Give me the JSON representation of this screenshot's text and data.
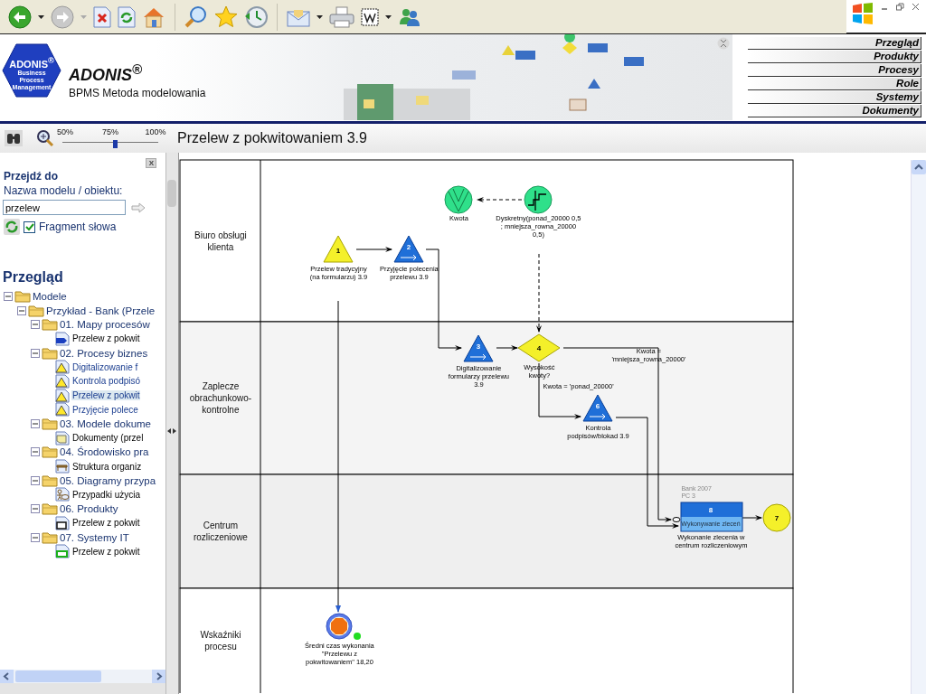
{
  "header": {
    "logo": "ADONIS$^{®}$",
    "logo_subtitle": "Business Process Management",
    "title": "ADONIS$^{®}$",
    "subtitle": "BPMS Metoda modelowania"
  },
  "nav": [
    {
      "label": "Przegląd"
    },
    {
      "label": "Produkty"
    },
    {
      "label": "Procesy"
    },
    {
      "label": "Role"
    },
    {
      "label": "Systemy"
    },
    {
      "label": "Dokumenty"
    }
  ],
  "zoom": {
    "ticks": [
      "50%",
      "75%",
      "100%"
    ],
    "level": 0.53
  },
  "model_title": "Przelew z pokwitowaniem 3.9",
  "sidebar": {
    "close": "X",
    "goto_heading": "Przejdź do",
    "field_label": "Nazwa modelu / obiektu:",
    "search": {
      "value": "przelew"
    },
    "fragment": {
      "label": "Fragment słowa",
      "checked": true
    },
    "overview_heading": "Przegląd",
    "tree": [
      {
        "kind": "folder",
        "label": "Modele",
        "expanded": true,
        "selected": false,
        "children": [
          {
            "kind": "folder",
            "label": "Przykład - Bank (Przele",
            "expanded": true,
            "selected": false,
            "children": [
              {
                "kind": "folder",
                "label": "01. Mapy procesów",
                "expanded": true,
                "selected": false,
                "children": [
                  {
                    "kind": "map",
                    "label": "Przelew z pokwit",
                    "selected": false
                  }
                ]
              },
              {
                "kind": "folder",
                "label": "02. Procesy biznes",
                "expanded": true,
                "selected": false,
                "children": [
                  {
                    "kind": "process",
                    "label": "Digitalizowanie f",
                    "selected": false
                  },
                  {
                    "kind": "process",
                    "label": "Kontrola podpisó",
                    "selected": false
                  },
                  {
                    "kind": "process",
                    "label": "Przelew z pokwit",
                    "selected": true
                  },
                  {
                    "kind": "process",
                    "label": "Przyjęcie polece",
                    "selected": false
                  }
                ]
              },
              {
                "kind": "folder",
                "label": "03. Modele dokume",
                "expanded": true,
                "selected": false,
                "children": [
                  {
                    "kind": "document",
                    "label": "Dokumenty (przel",
                    "selected": false
                  }
                ]
              },
              {
                "kind": "folder",
                "label": "04. Środowisko pra",
                "expanded": true,
                "selected": false,
                "children": [
                  {
                    "kind": "org",
                    "label": "Struktura organiz",
                    "selected": false
                  }
                ]
              },
              {
                "kind": "folder",
                "label": "05. Diagramy przypa",
                "expanded": true,
                "selected": false,
                "children": [
                  {
                    "kind": "usecase",
                    "label": "Przypadki użycia",
                    "selected": false
                  }
                ]
              },
              {
                "kind": "folder",
                "label": "06. Produkty",
                "expanded": true,
                "selected": false,
                "children": [
                  {
                    "kind": "product",
                    "label": "Przelew z pokwit",
                    "selected": false
                  }
                ]
              },
              {
                "kind": "folder",
                "label": "07. Systemy IT",
                "expanded": true,
                "selected": false,
                "children": [
                  {
                    "kind": "system",
                    "label": "Przelew z pokwit",
                    "selected": false
                  }
                ]
              }
            ]
          }
        ]
      }
    ]
  },
  "diagram": {
    "lanes": [
      {
        "label": "Biuro obsługi klienta"
      },
      {
        "label": "Zaplecze obrachunkowo-kontrolne"
      },
      {
        "label": "Centrum rozliczeniowe"
      },
      {
        "label": "Wskaźniki procesu"
      }
    ],
    "nodes": [
      {
        "kind": "variable",
        "label": "Kwota"
      },
      {
        "kind": "generator",
        "label": "Dyskretny(ponad_20000 0,5 ; mniejsza_rowna_20000 0,5)"
      },
      {
        "kind": "start",
        "number": "1",
        "label": "Przelew tradycyjny (na formularzu) 3.9"
      },
      {
        "kind": "activity",
        "number": "2",
        "label": "Przyjęcie polecenia przelewu 3.9"
      },
      {
        "kind": "activity",
        "number": "3",
        "label": "Digitalizowanie formularzy przelewu 3.9"
      },
      {
        "kind": "decision",
        "number": "4",
        "label": "Wysokość kwoty?"
      },
      {
        "kind": "activity",
        "number": "6",
        "label": "Kontrola podpisów/blokad 3.9"
      },
      {
        "kind": "subprocess",
        "number": "8",
        "caption": "Wykonywanie zleceń",
        "notes": [
          "Bank 2007",
          "PC 3"
        ],
        "label": "Wykonanie zlecenia w centrum rozliczeniowym"
      },
      {
        "kind": "end",
        "number": "7"
      },
      {
        "kind": "indicator",
        "label": "Średni czas wykonania \"Przelewu z pokwitowaniem\" 18,20",
        "color": "#22dd22"
      }
    ],
    "conditions": [
      "Kwota = 'ponad_20000'",
      "Kwota = 'mniejsza_rowna_20000'"
    ]
  }
}
